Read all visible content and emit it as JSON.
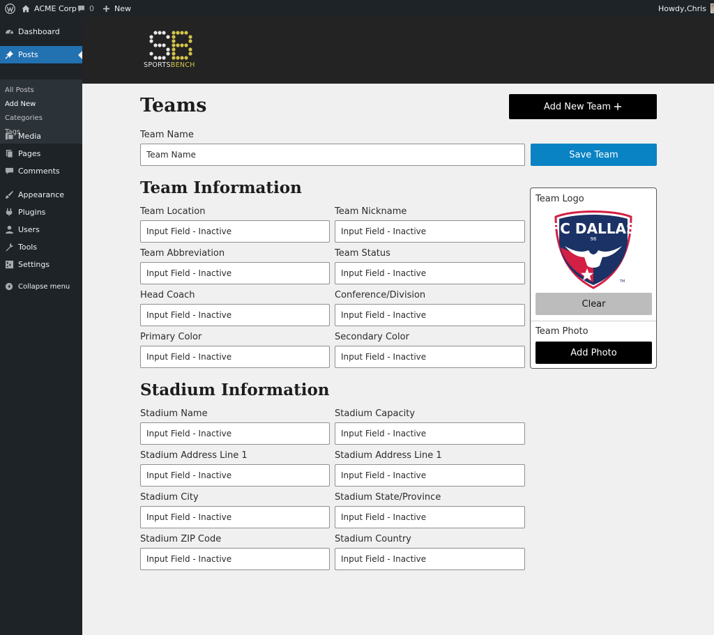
{
  "admin_bar": {
    "site_name": "ACME Corp",
    "comment_count": "0",
    "new_label": "New",
    "greeting": "Howdy,Chris"
  },
  "sidebar": {
    "items": [
      {
        "label": "Dashboard",
        "icon": "dashboard-icon"
      },
      {
        "label": "Posts",
        "icon": "pushpin-icon"
      },
      {
        "label": "Media",
        "icon": "media-icon"
      },
      {
        "label": "Pages",
        "icon": "pages-icon"
      },
      {
        "label": "Comments",
        "icon": "comment-icon"
      },
      {
        "label": "Appearance",
        "icon": "paintbrush-icon"
      },
      {
        "label": "Plugins",
        "icon": "plugin-icon"
      },
      {
        "label": "Users",
        "icon": "user-icon"
      },
      {
        "label": "Tools",
        "icon": "wrench-icon"
      },
      {
        "label": "Settings",
        "icon": "settings-icon"
      },
      {
        "label": "Collapse menu",
        "icon": "collapse-icon"
      }
    ],
    "submenu": [
      "All Posts",
      "Add New",
      "Categories",
      "Tags"
    ],
    "active_color": "#2271b1"
  },
  "brand": {
    "logo_letters": "SB",
    "word_1": "SPORTS",
    "word_2": "BENCH",
    "accent": "#d4c34a"
  },
  "page": {
    "title": "Teams",
    "add_button": "Add New Team",
    "team_name_label": "Team Name",
    "team_name_placeholder": "Team Name",
    "save_button": "Save Team"
  },
  "team_info": {
    "heading": "Team Information",
    "fields": [
      {
        "label": "Team Location",
        "placeholder": "Input Field - Inactive"
      },
      {
        "label": "Team Nickname",
        "placeholder": "Input Field - Inactive"
      },
      {
        "label": "Team Abbreviation",
        "placeholder": "Input Field - Inactive"
      },
      {
        "label": "Team Status",
        "placeholder": "Input Field - Inactive"
      },
      {
        "label": "Head Coach",
        "placeholder": "Input Field - Inactive"
      },
      {
        "label": "Conference/Division",
        "placeholder": "Input Field - Inactive"
      },
      {
        "label": "Primary Color",
        "placeholder": "Input Field - Inactive"
      },
      {
        "label": "Secondary Color",
        "placeholder": "Input Field - Inactive"
      }
    ]
  },
  "stadium_info": {
    "heading": "Stadium Information",
    "fields": [
      {
        "label": "Stadium Name",
        "placeholder": "Input Field - Inactive"
      },
      {
        "label": "Stadium Capacity",
        "placeholder": "Input Field - Inactive"
      },
      {
        "label": "Stadium Address Line 1",
        "placeholder": "Input Field - Inactive"
      },
      {
        "label": "Stadium Address Line 1",
        "placeholder": "Input Field - Inactive"
      },
      {
        "label": "Stadium City",
        "placeholder": "Input Field - Inactive"
      },
      {
        "label": "Stadium State/Province",
        "placeholder": "Input Field - Inactive"
      },
      {
        "label": "Stadium ZIP Code",
        "placeholder": "Input Field - Inactive"
      },
      {
        "label": "Stadium Country",
        "placeholder": "Input Field - Inactive"
      }
    ]
  },
  "media_card": {
    "logo_label": "Team Logo",
    "crest_text": "FC DALLAS",
    "crest_year": "96",
    "crest_tm": "TM",
    "clear_button": "Clear",
    "photo_label": "Team Photo",
    "add_photo_button": "Add Photo"
  },
  "colors": {
    "save_blue": "#0a83c4",
    "crest_navy": "#1b3266",
    "crest_red": "#d21f43"
  }
}
